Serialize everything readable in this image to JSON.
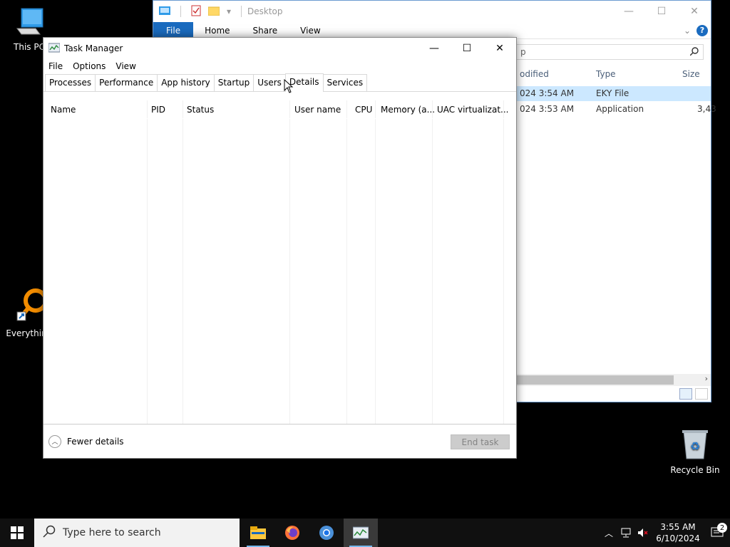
{
  "desktop": {
    "icons": [
      {
        "label": "This PC"
      },
      {
        "label": "Everythin"
      },
      {
        "label": "Recycle Bin"
      }
    ]
  },
  "explorer": {
    "title": "Desktop",
    "ribbon_tabs": [
      "File",
      "Home",
      "Share",
      "View"
    ],
    "search_partial": "p",
    "columns": [
      "odified",
      "Type",
      "Size"
    ],
    "rows": [
      {
        "modified": "024 3:54 AM",
        "type": "EKY File",
        "size": ""
      },
      {
        "modified": "024 3:53 AM",
        "type": "Application",
        "size": "3,43"
      }
    ]
  },
  "taskmgr": {
    "title": "Task Manager",
    "menu": [
      "File",
      "Options",
      "View"
    ],
    "tabs": [
      "Processes",
      "Performance",
      "App history",
      "Startup",
      "Users",
      "Details",
      "Services"
    ],
    "active_tab": "Details",
    "columns": [
      "Name",
      "PID",
      "Status",
      "User name",
      "CPU",
      "Memory (a...",
      "UAC virtualizat..."
    ],
    "fewer_details": "Fewer details",
    "end_task": "End task"
  },
  "taskbar": {
    "search_placeholder": "Type here to search",
    "time": "3:55 AM",
    "date": "6/10/2024",
    "notification_count": "2"
  },
  "colors": {
    "accent": "#1a6bbf",
    "taskbar": "#101010",
    "selection": "#cce8ff"
  }
}
